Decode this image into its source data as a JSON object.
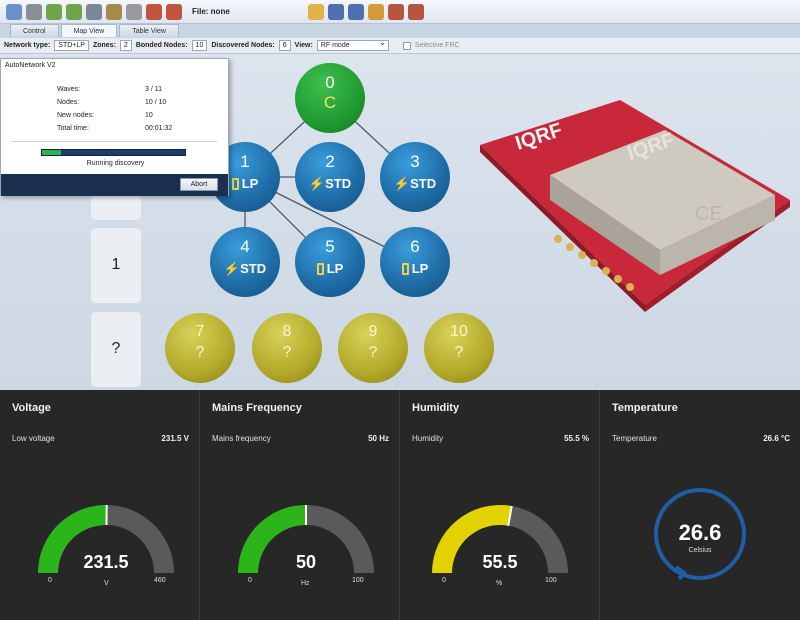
{
  "toolbar": {
    "file_label": "File: none"
  },
  "tabs": [
    {
      "label": "Control",
      "active": false
    },
    {
      "label": "Map View",
      "active": true
    },
    {
      "label": "Table View",
      "active": false
    }
  ],
  "netbar": {
    "network_type_label": "Network type:",
    "network_type_value": "STD+LP",
    "zones_label": "Zones:",
    "zones_value": "2",
    "bonded_label": "Bonded Nodes:",
    "bonded_value": "10",
    "discovered_label": "Discovered Nodes:",
    "discovered_value": "6",
    "view_label": "View:",
    "view_value": "RF mode",
    "selective_frc_label": "Selective FRC"
  },
  "side_tiles": [
    {
      "label": ""
    },
    {
      "label": "1"
    },
    {
      "label": "?"
    }
  ],
  "popup": {
    "title": "AutoNetwork V2",
    "rows": [
      {
        "label": "Waves:",
        "value": "3 / 11"
      },
      {
        "label": "Nodes:",
        "value": "10 / 10"
      },
      {
        "label": "New nodes:",
        "value": "10"
      },
      {
        "label": "Total time:",
        "value": "00:01:32"
      }
    ],
    "progress": 0.13,
    "status": "Running discovery",
    "abort_label": "Abort"
  },
  "nodes": [
    {
      "num": "0",
      "type": "C",
      "color": "green",
      "icon": "coordinator"
    },
    {
      "num": "1",
      "type": "LP",
      "color": "blue",
      "icon": "battery-icon"
    },
    {
      "num": "2",
      "type": "STD",
      "color": "blue",
      "icon": "plug-icon"
    },
    {
      "num": "3",
      "type": "STD",
      "color": "blue",
      "icon": "plug-icon"
    },
    {
      "num": "4",
      "type": "STD",
      "color": "blue",
      "icon": "plug-icon"
    },
    {
      "num": "5",
      "type": "LP",
      "color": "blue",
      "icon": "battery-icon"
    },
    {
      "num": "6",
      "type": "LP",
      "color": "blue",
      "icon": "battery-icon"
    },
    {
      "num": "7",
      "type": "?",
      "color": "yellow",
      "icon": ""
    },
    {
      "num": "8",
      "type": "?",
      "color": "yellow",
      "icon": ""
    },
    {
      "num": "9",
      "type": "?",
      "color": "yellow",
      "icon": ""
    },
    {
      "num": "10",
      "type": "?",
      "color": "yellow",
      "icon": ""
    }
  ],
  "module": {
    "logo_text": "IQRF"
  },
  "colors": {
    "gauge_green": "#2bb51a",
    "gauge_yellow": "#e2d300",
    "gauge_track": "#5a5a5a",
    "temp_ring": "#1f5fa6",
    "dash_bg": "#222222"
  },
  "cards": [
    {
      "title": "Voltage",
      "sub_label": "Low voltage",
      "sub_value": "231.5 V",
      "gauge_value": "231.5",
      "gauge_unit": "V",
      "gauge_min": "0",
      "gauge_max": "460",
      "value": 231.5,
      "min": 0,
      "max": 460,
      "color": "green"
    },
    {
      "title": "Mains Frequency",
      "sub_label": "Mains frequency",
      "sub_value": "50 Hz",
      "gauge_value": "50",
      "gauge_unit": "Hz",
      "gauge_min": "0",
      "gauge_max": "100",
      "value": 50,
      "min": 0,
      "max": 100,
      "color": "green"
    },
    {
      "title": "Humidity",
      "sub_label": "Humidity",
      "sub_value": "55.5 %",
      "gauge_value": "55.5",
      "gauge_unit": "%",
      "gauge_min": "0",
      "gauge_max": "100",
      "value": 55.5,
      "min": 0,
      "max": 100,
      "color": "yellow"
    },
    {
      "title": "Temperature",
      "sub_label": "Temperature",
      "sub_value": "26.6 °C",
      "gauge_value": "26.6",
      "gauge_unit": "Celsius",
      "value": 26.6,
      "kind": "ring"
    }
  ]
}
